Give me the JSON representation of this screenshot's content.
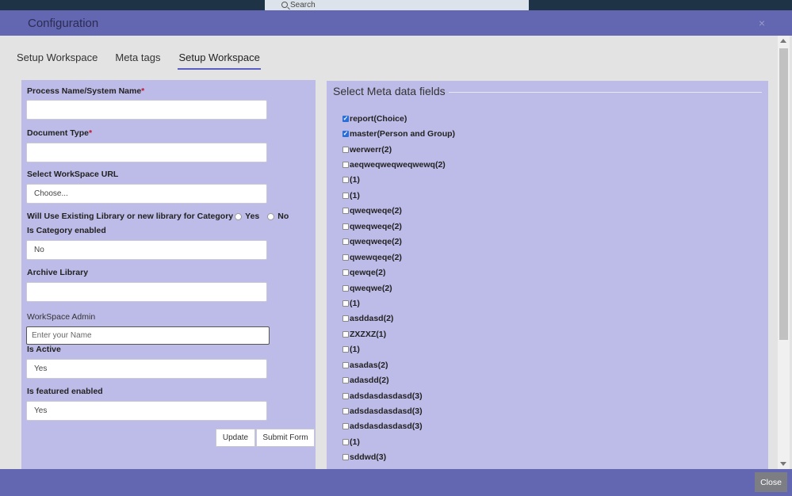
{
  "backdrop": {
    "search_label": "Search"
  },
  "modal": {
    "title": "Configuration",
    "close_glyph": "×",
    "footer_close_label": "Close"
  },
  "tabs": [
    {
      "label": "Setup Workspace",
      "active": false
    },
    {
      "label": "Meta tags",
      "active": false
    },
    {
      "label": "Setup Workspace",
      "active": true
    }
  ],
  "form": {
    "process_name_label": "Process Name/System Name",
    "process_name_value": "",
    "document_type_label": "Document Type",
    "document_type_value": "",
    "required_mark": "*",
    "workspace_url_label": "Select WorkSpace URL",
    "workspace_url_value": "Choose...",
    "existing_library_label": "Will Use Existing Library or new library for Category",
    "radio_yes": "Yes",
    "radio_no": "No",
    "category_enabled_label": "Is Category enabled",
    "category_enabled_value": "No",
    "archive_library_label": "Archive Library",
    "archive_library_value": "",
    "workspace_admin_label": "WorkSpace Admin",
    "workspace_admin_placeholder": "Enter your Name",
    "is_active_label": "Is Active",
    "is_active_value": "Yes",
    "featured_label": "Is featured enabled",
    "featured_value": "Yes",
    "update_button": "Update",
    "submit_button": "Submit Form"
  },
  "meta": {
    "title": "Select Meta data fields",
    "items": [
      {
        "label": "report(Choice)",
        "checked": true
      },
      {
        "label": "master(Person and Group)",
        "checked": true
      },
      {
        "label": "werwerr(2)",
        "checked": false
      },
      {
        "label": "aeqweqweqweqwewq(2)",
        "checked": false
      },
      {
        "label": "(1)",
        "checked": false
      },
      {
        "label": "(1)",
        "checked": false
      },
      {
        "label": "qweqweqe(2)",
        "checked": false
      },
      {
        "label": "qweqweqe(2)",
        "checked": false
      },
      {
        "label": "qweqweqe(2)",
        "checked": false
      },
      {
        "label": "qwewqeqe(2)",
        "checked": false
      },
      {
        "label": "qewqe(2)",
        "checked": false
      },
      {
        "label": "qweqwe(2)",
        "checked": false
      },
      {
        "label": "(1)",
        "checked": false
      },
      {
        "label": "asddasd(2)",
        "checked": false
      },
      {
        "label": "ZXZXZ(1)",
        "checked": false
      },
      {
        "label": "(1)",
        "checked": false
      },
      {
        "label": "asadas(2)",
        "checked": false
      },
      {
        "label": "adasdd(2)",
        "checked": false
      },
      {
        "label": "adsdasdasdasd(3)",
        "checked": false
      },
      {
        "label": "adsdasdasdasd(3)",
        "checked": false
      },
      {
        "label": "adsdasdasdasd(3)",
        "checked": false
      },
      {
        "label": "(1)",
        "checked": false
      },
      {
        "label": "sddwd(3)",
        "checked": false
      }
    ]
  },
  "colors": {
    "header": "#6366b0",
    "panel": "#bdbbe7",
    "tab_underline": "#5b5ec2",
    "required": "#c8102e",
    "checkbox_checked": "#2b6fd6"
  }
}
